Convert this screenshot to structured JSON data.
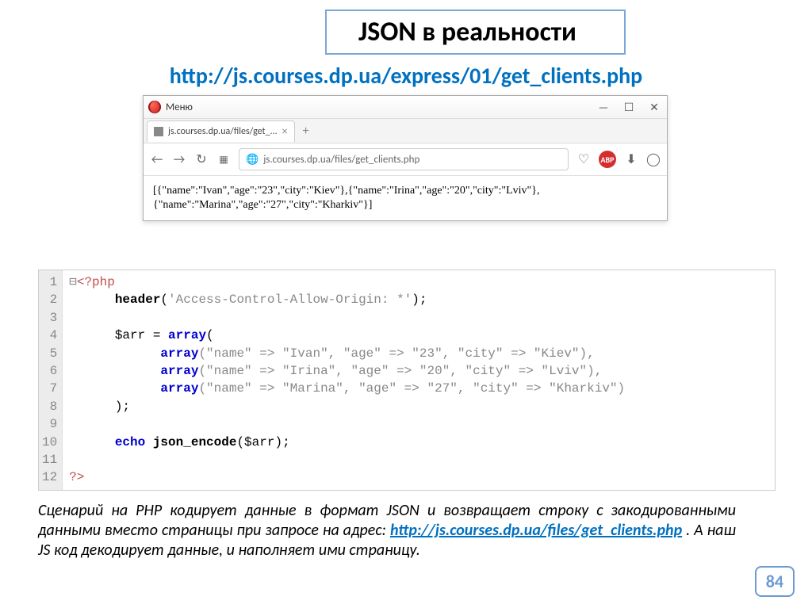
{
  "title": "JSON в реальности",
  "url_top": "http://js.courses.dp.ua/express/01/get_clients.php",
  "browser": {
    "menu_label": "Меню",
    "tab_title": "js.courses.dp.ua/files/get_...",
    "url_text": "js.courses.dp.ua/files/get_clients.php",
    "content": "[{\"name\":\"Ivan\",\"age\":\"23\",\"city\":\"Kiev\"},{\"name\":\"Irina\",\"age\":\"20\",\"city\":\"Lviv\"},{\"name\":\"Marina\",\"age\":\"27\",\"city\":\"Kharkiv\"}]",
    "abp_label": "ABP"
  },
  "code": {
    "line_numbers": [
      "1",
      "2",
      "3",
      "4",
      "5",
      "6",
      "7",
      "8",
      "9",
      "10",
      "11",
      "12"
    ],
    "l1_open": "<?php",
    "l2_header": "header",
    "l2_str": "'Access-Control-Allow-Origin: *'",
    "l4_var": "$arr",
    "l4_eq": " = ",
    "l4_array": "array",
    "l5_array": "array",
    "l5_body": "(\"name\" => \"Ivan\", \"age\" => \"23\", \"city\" => \"Kiev\"),",
    "l6_array": "array",
    "l6_body": "(\"name\" => \"Irina\", \"age\" => \"20\", \"city\" => \"Lviv\"),",
    "l7_array": "array",
    "l7_body": "(\"name\" => \"Marina\", \"age\" => \"27\", \"city\" => \"Kharkiv\")",
    "l8_close": ");",
    "l10_echo": "echo",
    "l10_fn": "json_encode",
    "l10_rest": "($arr);",
    "l12_close": "?>"
  },
  "paragraph": {
    "part1": "Сценарий на PHP кодирует данные в формат JSON и возвращает строку с закодированными данными вместо страницы при запросе на адрес: ",
    "link_text": "http://js.courses.dp.ua/files/get_clients.php",
    "part2": " . А наш JS код декодирует данные, и наполняет  ими страницу."
  },
  "page_number": "84"
}
